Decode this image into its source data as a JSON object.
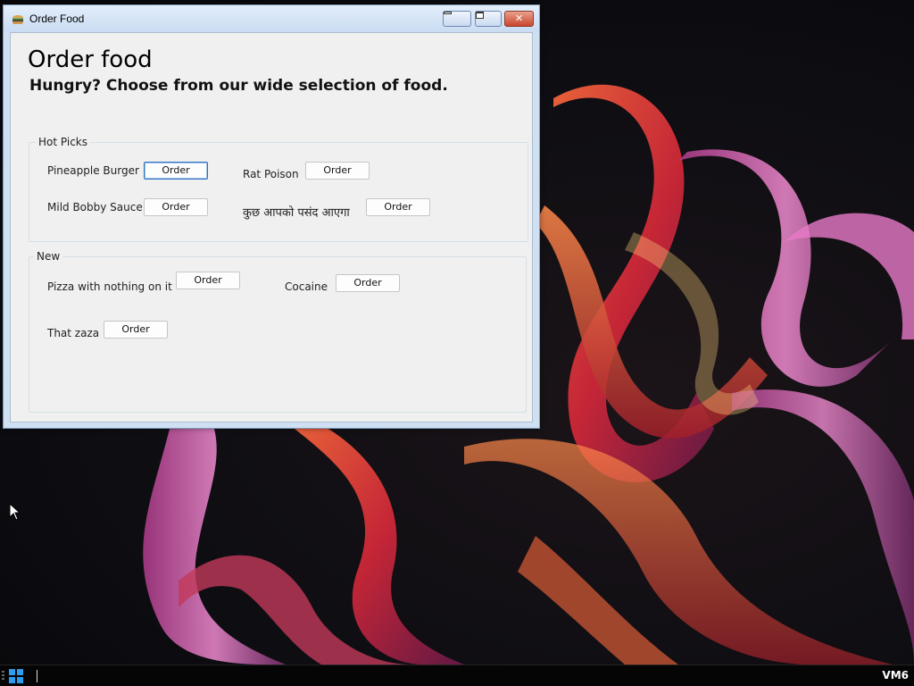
{
  "window": {
    "title": "Order Food",
    "icon": "burger-icon",
    "controls": {
      "minimize": "minimize-icon",
      "maximize": "maximize-icon",
      "close": "close-icon"
    }
  },
  "page": {
    "heading": "Order food",
    "subheading": "Hungry? Choose from our wide selection of food."
  },
  "hot_picks": {
    "legend": "Hot Picks",
    "items": [
      {
        "label": "Pineapple Burger",
        "button": "Order"
      },
      {
        "label": "Rat Poison",
        "button": "Order"
      },
      {
        "label": "Mild Bobby Sauce",
        "button": "Order"
      },
      {
        "label": "कुछ आपको पसंद आएगा",
        "button": "Order"
      }
    ]
  },
  "new": {
    "legend": "New",
    "items": [
      {
        "label": "Pizza with nothing on it",
        "button": "Order"
      },
      {
        "label": "Cocaine",
        "button": "Order"
      },
      {
        "label": "That zaza",
        "button": "Order"
      }
    ]
  },
  "taskbar": {
    "start_icon": "windows-logo-icon",
    "host_label": "VM6"
  },
  "colors": {
    "window_frame": "#cfe0f3",
    "client_bg": "#f0f0f0",
    "close_button": "#c9462c",
    "focus_border": "#2f6fbd",
    "taskbar": "#050505"
  }
}
